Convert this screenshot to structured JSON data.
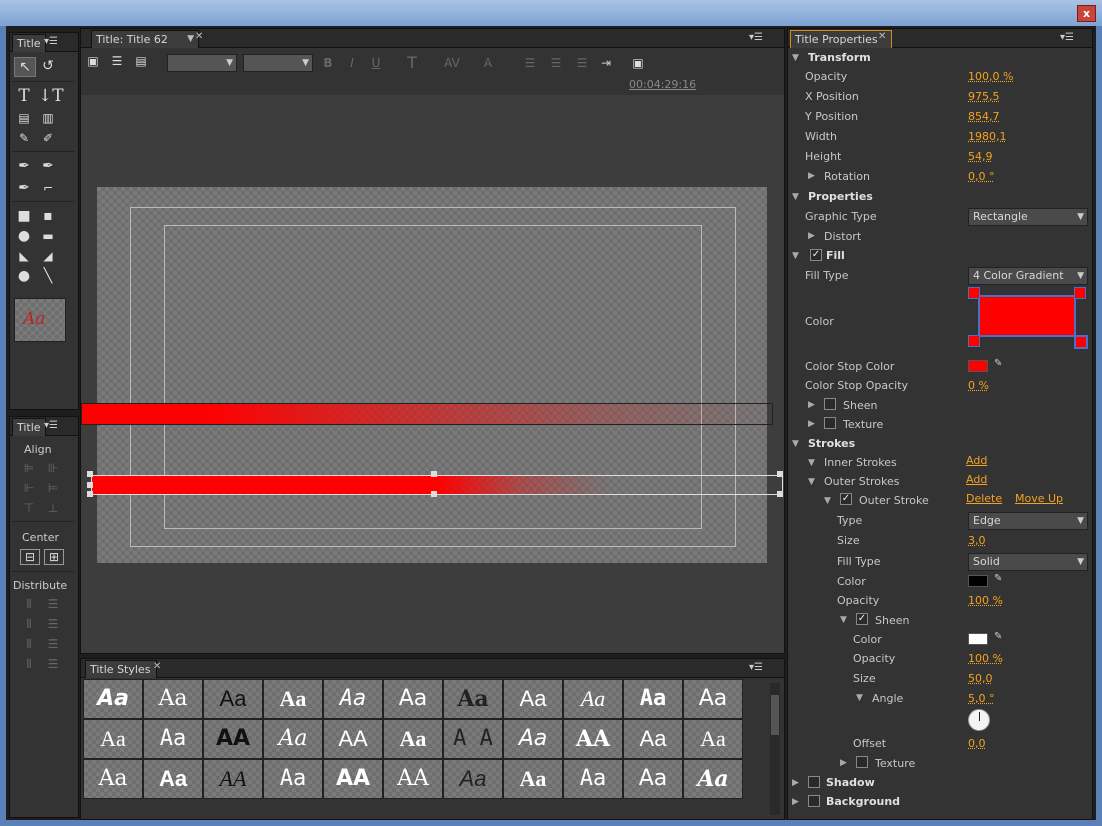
{
  "window": {
    "close_label": "x"
  },
  "tools_panel": {
    "tab_label": "Title",
    "menu_icon": "▾☰",
    "preview_text": "Aa"
  },
  "align_panel": {
    "tab_label": "Title",
    "align_label": "Align",
    "center_label": "Center",
    "distribute_label": "Distribute"
  },
  "title_panel": {
    "tab_label": "Title: Title 62",
    "timecode": "00:04:29:16"
  },
  "title_styles": {
    "tab_label": "Title Styles",
    "samples": [
      [
        "Aa",
        "Aa",
        "Aa",
        "Aa",
        "Aa",
        "Aa",
        "Aa",
        "Aa",
        "Aa",
        "Aa",
        "Aa"
      ],
      [
        "Aa",
        "Aa",
        "AA",
        "Aa",
        "AA",
        "Aa",
        "A A",
        "Aa",
        "AA",
        "Aa",
        "Aa"
      ],
      [
        "Aa",
        "Aa",
        "AA",
        "Aa",
        "AA",
        "AA",
        "Aa",
        "Aa",
        "Aa",
        "Aa",
        "Aa"
      ]
    ]
  },
  "properties_panel": {
    "tab_label": "Title Properties",
    "transform": {
      "header": "Transform",
      "opacity_label": "Opacity",
      "opacity": "100,0 %",
      "x_label": "X Position",
      "x": "975,5",
      "y_label": "Y Position",
      "y": "854,7",
      "width_label": "Width",
      "width": "1980,1",
      "height_label": "Height",
      "height": "54,9",
      "rotation_label": "Rotation",
      "rotation": "0,0 °"
    },
    "properties": {
      "header": "Properties",
      "graphic_type_label": "Graphic Type",
      "graphic_type": "Rectangle",
      "distort_label": "Distort"
    },
    "fill": {
      "header": "Fill",
      "fill_type_label": "Fill Type",
      "fill_type": "4 Color Gradient",
      "color_label": "Color",
      "stop_color_label": "Color Stop Color",
      "stop_opacity_label": "Color Stop Opacity",
      "stop_opacity": "0 %",
      "sheen_label": "Sheen",
      "texture_label": "Texture"
    },
    "strokes": {
      "header": "Strokes",
      "inner_label": "Inner Strokes",
      "inner_add": "Add",
      "outer_label": "Outer Strokes",
      "outer_add": "Add",
      "outer_stroke_label": "Outer Stroke",
      "delete": "Delete",
      "move_up": "Move Up",
      "type_label": "Type",
      "type": "Edge",
      "size_label": "Size",
      "size": "3,0",
      "fill_type_label": "Fill Type",
      "fill_type": "Solid",
      "color_label": "Color",
      "opacity_label": "Opacity",
      "opacity": "100 %",
      "sheen_label": "Sheen",
      "sheen_color_label": "Color",
      "sheen_opacity_label": "Opacity",
      "sheen_opacity": "100 %",
      "sheen_size_label": "Size",
      "sheen_size": "50,0",
      "angle_label": "Angle",
      "angle": "5,0 °",
      "offset_label": "Offset",
      "offset": "0,0",
      "texture_label": "Texture"
    },
    "shadow_label": "Shadow",
    "background_label": "Background"
  },
  "colors": {
    "fill_red": "#ff0000",
    "accent": "#f2a322",
    "stroke_color": "#000000",
    "sheen_color": "#ffffff"
  }
}
